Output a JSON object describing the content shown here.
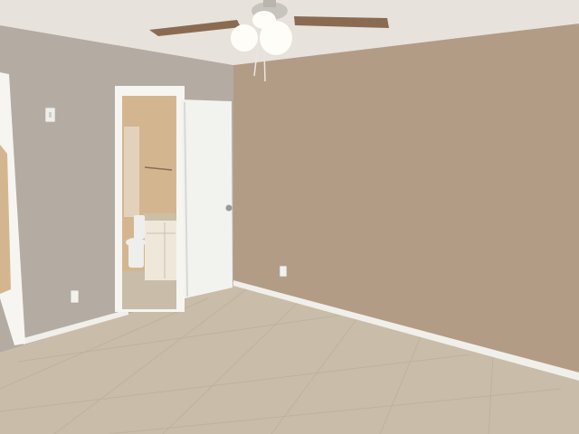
{
  "scene": {
    "subject": "empty bedroom",
    "colors": {
      "ceiling": "#e7e2dc",
      "left_wall": "#b4aba2",
      "right_wall": "#b29c86",
      "floor": "#c9bda9",
      "baseboard": "#f1efea",
      "door": "#f2f2ef",
      "door_frame": "#f6f5f1",
      "bathroom_wall": "#d3b690",
      "cabinet": "#efe8da",
      "countertop": "#cbbfa6",
      "toilet": "#eeeeec",
      "fan_blade": "#8a6b52",
      "light_globe": "#fffdf8",
      "tile_line": "#bfb29c"
    },
    "icons": [
      "ceiling-fan-icon",
      "light-switch-icon",
      "outlet-icon",
      "door-knob-icon",
      "toilet-icon"
    ]
  }
}
